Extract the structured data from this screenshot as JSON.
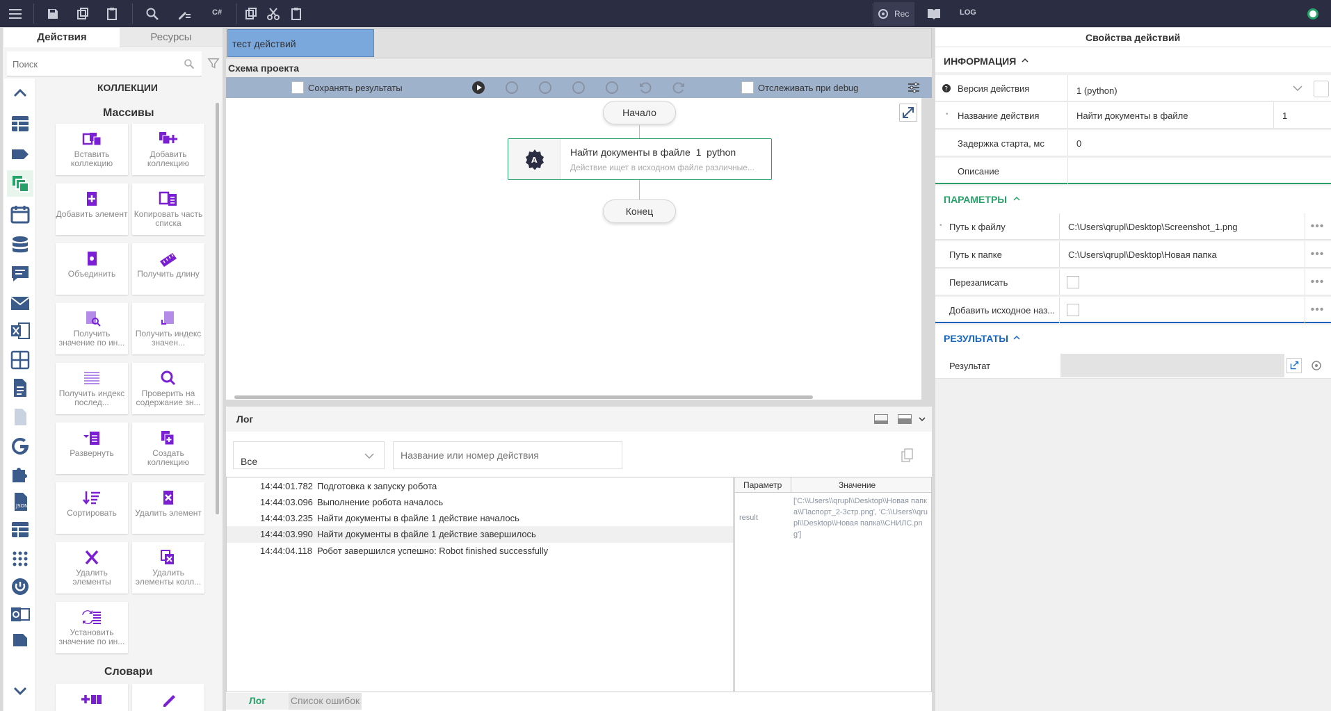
{
  "toolbar": {
    "rec_label": "Rec",
    "log_label": "LOG",
    "lang_label": "C#"
  },
  "left": {
    "tabs": [
      "Действия",
      "Ресурсы"
    ],
    "search_placeholder": "Поиск",
    "header": "КОЛЛЕКЦИИ",
    "section_arrays": "Массивы",
    "section_dicts": "Словари",
    "items": [
      {
        "label": "Вставить коллекцию"
      },
      {
        "label": "Добавить коллекцию"
      },
      {
        "label": "Добавить элемент"
      },
      {
        "label": "Копировать часть списка"
      },
      {
        "label": "Объединить"
      },
      {
        "label": "Получить длину"
      },
      {
        "label": "Получить значение по ин..."
      },
      {
        "label": "Получить индекс значен..."
      },
      {
        "label": "Получить индекс послед..."
      },
      {
        "label": "Проверить на содержание зн..."
      },
      {
        "label": "Развернуть"
      },
      {
        "label": "Создать коллекцию"
      },
      {
        "label": "Сортировать"
      },
      {
        "label": "Удалить элемент"
      },
      {
        "label": "Удалить элементы"
      },
      {
        "label": "Удалить элементы колл..."
      },
      {
        "label": "Установить значение по ин..."
      }
    ]
  },
  "center": {
    "tab_name": "тест действий",
    "schema_title": "Схема проекта",
    "save_results": "Сохранять результаты",
    "track_debug": "Отслеживать при debug",
    "start": "Начало",
    "end": "Конец",
    "node_title": "Найти документы в файле  1  python",
    "node_desc": "Действие ищет в исходном файле различные..."
  },
  "log": {
    "title": "Лог",
    "filter_value": "Все",
    "search_placeholder": "Название или номер действия",
    "entries": [
      {
        "time": "14:44:01.782",
        "msg": "Подготовка к запуску робота"
      },
      {
        "time": "14:44:03.096",
        "msg": "Выполнение робота началось"
      },
      {
        "time": "14:44:03.235",
        "msg": "Найти документы в файле 1 действие началось"
      },
      {
        "time": "14:44:03.990",
        "msg": "Найти документы в файле 1 действие завершилось"
      },
      {
        "time": "14:44:04.118",
        "msg": "Робот завершился успешно: Robot finished successfully"
      }
    ],
    "param_header": "Параметр",
    "value_header": "Значение",
    "result_param": "result",
    "result_value": "['C:\\\\Users\\\\qrupl\\\\Desktop\\\\Новая папка\\\\Паспорт_2-3стр.png', 'C:\\\\Users\\\\qrupl\\\\Desktop\\\\Новая папка\\\\СНИЛС.png']",
    "bottom_tabs": [
      "Лог",
      "Список ошибок"
    ]
  },
  "props": {
    "title": "Свойства действий",
    "info_header": "ИНФОРМАЦИЯ",
    "params_header": "ПАРАМЕТРЫ",
    "results_header": "РЕЗУЛЬТАТЫ",
    "version_label": "Версия действия",
    "version_value": "1 (python)",
    "name_label": "Название действия",
    "name_value": "Найти документы в файле",
    "name_index": "1",
    "delay_label": "Задержка старта, мс",
    "delay_value": "0",
    "desc_label": "Описание",
    "path_file_label": "Путь к файлу",
    "path_file_value": "C:\\Users\\qrupl\\Desktop\\Screenshot_1.png",
    "path_folder_label": "Путь к папке",
    "path_folder_value": "C:\\Users\\qrupl\\Desktop\\Новая папка",
    "overwrite_label": "Перезаписать",
    "add_name_label": "Добавить исходное наз...",
    "result_label": "Результат"
  },
  "colors": {
    "accent": "#7b1fd4",
    "green": "#26a269",
    "blue": "#1565c0",
    "topbar": "#2b2d42"
  }
}
